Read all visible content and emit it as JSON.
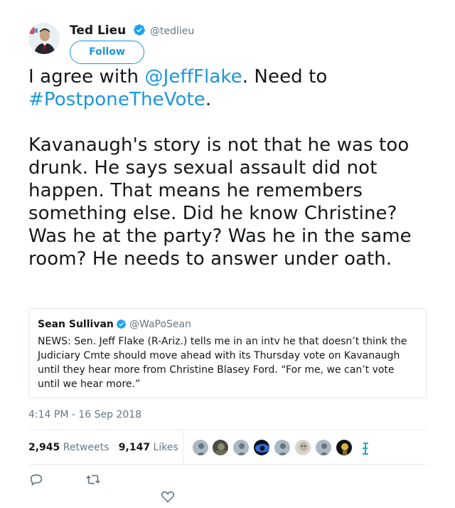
{
  "author": {
    "name": "Ted Lieu",
    "handle": "@tedlieu",
    "follow_label": "Follow",
    "avatar": "avatar-icon"
  },
  "tweet": {
    "line1_prefix": "I agree with ",
    "mention": "@JeffFlake",
    "line1_suffix": ". Need to",
    "hashtag": "#PostponeTheVote",
    "hashtag_suffix": ".",
    "para2": "Kavanaugh's story is not that he was too drunk. He says sexual assault did not happen. That means he remembers something else. Did he know Christine? Was he at the party? Was he in the same room? He needs to answer under oath."
  },
  "quote": {
    "name": "Sean Sullivan",
    "handle": "@WaPoSean",
    "text": "NEWS: Sen. Jeff Flake (R-Ariz.) tells me in an intv he that doesn’t think the Judiciary Cmte should move ahead with its Thursday vote on Kavanaugh until they hear more from Christine Blasey Ford. “For me, we can’t vote until we hear more.”"
  },
  "timestamp": "4:14 PM - 16 Sep 2018",
  "stats": {
    "retweets_count": "2,945",
    "retweets_label": "Retweets",
    "likes_count": "9,147",
    "likes_label": "Likes"
  },
  "colors": {
    "accent": "#1b95e0",
    "muted": "#657786",
    "text": "#14171a"
  }
}
